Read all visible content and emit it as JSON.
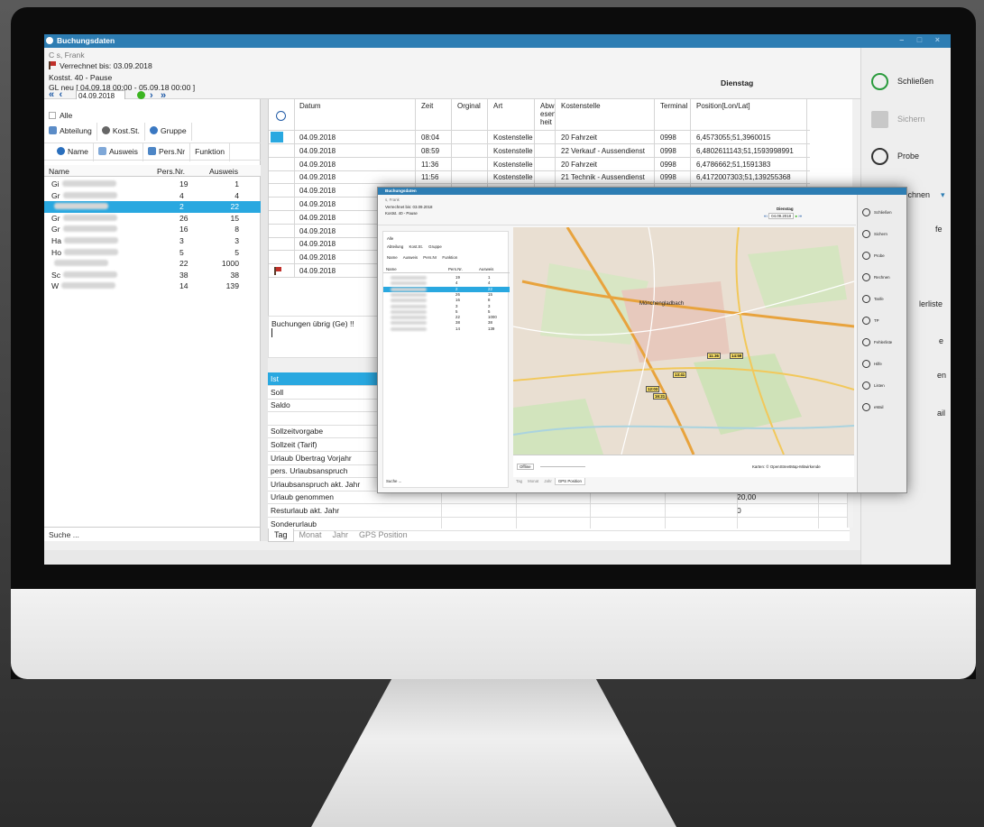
{
  "window": {
    "title": "Buchungsdaten",
    "controls": "– □ ×"
  },
  "header": {
    "person": "C    s, Frank",
    "verrechnet": "Verrechnet bis: 03.09.2018",
    "kostst": "Kostst. 40 - Pause",
    "gl": "GL neu  [ 04.09.18 00:00 - 05.09.18 00:00 ]",
    "day": "Dienstag",
    "date": "04.09.2018"
  },
  "left": {
    "alle": "Alle",
    "group_buttons": [
      "Abteilung",
      "Kost.St.",
      "Gruppe"
    ],
    "sort_buttons": [
      "Name",
      "Ausweis",
      "Pers.Nr",
      "Funktion"
    ],
    "columns": [
      "Name",
      "Pers.Nr.",
      "Ausweis"
    ],
    "rows": [
      {
        "name": "Gi",
        "pers": "19",
        "ausweis": "1"
      },
      {
        "name": "Gr",
        "pers": "4",
        "ausweis": "4"
      },
      {
        "name": "",
        "pers": "2",
        "ausweis": "22"
      },
      {
        "name": "Gr",
        "pers": "26",
        "ausweis": "15"
      },
      {
        "name": "Gr",
        "pers": "16",
        "ausweis": "8"
      },
      {
        "name": "Ha",
        "pers": "3",
        "ausweis": "3"
      },
      {
        "name": "Ho",
        "pers": "5",
        "ausweis": "5"
      },
      {
        "name": "",
        "pers": "22",
        "ausweis": "1000"
      },
      {
        "name": "Sc",
        "pers": "38",
        "ausweis": "38"
      },
      {
        "name": "W",
        "pers": "14",
        "ausweis": "139"
      }
    ],
    "search_placeholder": "Suche ..."
  },
  "main": {
    "columns": [
      "Datum",
      "Zeit",
      "Orginal",
      "Art",
      "Abw esen heit",
      "Kostenstelle",
      "Terminal",
      "Position[Lon/Lat]"
    ],
    "rows": [
      {
        "datum": "04.09.2018",
        "zeit": "08:04",
        "art": "Kostenstelle",
        "kst": "20 Fahrzeit",
        "term": "0998",
        "pos": "6,4573055;51,3960015"
      },
      {
        "datum": "04.09.2018",
        "zeit": "08:59",
        "art": "Kostenstelle",
        "kst": "22 Verkauf - Aussendienst",
        "term": "0998",
        "pos": "6,4802611143;51,1593998991"
      },
      {
        "datum": "04.09.2018",
        "zeit": "11:36",
        "art": "Kostenstelle",
        "kst": "20 Fahrzeit",
        "term": "0998",
        "pos": "6,4786662;51,1591383"
      },
      {
        "datum": "04.09.2018",
        "zeit": "11:56",
        "art": "Kostenstelle",
        "kst": "21 Technik - Aussendienst",
        "term": "0998",
        "pos": "6,4172007303;51,139255368"
      },
      {
        "datum": "04.09.2018",
        "zeit": "",
        "art": "",
        "kst": "",
        "term": "",
        "pos": ""
      },
      {
        "datum": "04.09.2018",
        "zeit": "",
        "art": "",
        "kst": "",
        "term": "",
        "pos": ""
      },
      {
        "datum": "04.09.2018",
        "zeit": "",
        "art": "",
        "kst": "",
        "term": "",
        "pos": ""
      },
      {
        "datum": "04.09.2018",
        "zeit": "",
        "art": "",
        "kst": "",
        "term": "",
        "pos": ""
      },
      {
        "datum": "04.09.2018",
        "zeit": "",
        "art": "",
        "kst": "",
        "term": "",
        "pos": ""
      },
      {
        "datum": "04.09.2018",
        "zeit": "",
        "art": "",
        "kst": "",
        "term": "",
        "pos": ""
      },
      {
        "datum": "04.09.2018",
        "zeit": "",
        "art": "",
        "kst": "",
        "term": "",
        "pos": ""
      }
    ],
    "note": "Buchungen übrig (Ge) !!",
    "summary": [
      {
        "label": "Ist",
        "value": ""
      },
      {
        "label": "Soll",
        "value": ""
      },
      {
        "label": "Saldo",
        "value": ""
      },
      {
        "label": "",
        "value": ""
      },
      {
        "label": "Sollzeitvorgabe",
        "value": ""
      },
      {
        "label": "Sollzeit (Tarif)",
        "value": ""
      },
      {
        "label": "Urlaub Übertrag Vorjahr",
        "value": ""
      },
      {
        "label": "pers. Urlaubsanspruch",
        "value": ""
      },
      {
        "label": "Urlaubsanspruch akt. Jahr",
        "value": ""
      },
      {
        "label": "Urlaub genommen",
        "value": "20,00"
      },
      {
        "label": "Resturlaub akt. Jahr",
        "value": "0"
      },
      {
        "label": "Sonderurlaub",
        "value": ""
      }
    ],
    "tabs": [
      "Tag",
      "Monat",
      "Jahr",
      "GPS Position"
    ]
  },
  "right": {
    "buttons": [
      "Schließen",
      "Sichern",
      "Probe",
      "Rechnen"
    ],
    "partial_labels": [
      "fe",
      "lerliste",
      "e",
      "en",
      "ail"
    ]
  },
  "overlay": {
    "title": "Buchungsdaten",
    "person": "s, Frank",
    "verrechnet": "Verrechnet bis: 03.09.2018",
    "kostst": "Kostst. 40 - Pause",
    "day": "Dienstag",
    "date": "04.09.2018",
    "alle": "Alle",
    "group_buttons": [
      "Abteilung",
      "Kost.St.",
      "Gruppe"
    ],
    "sort_buttons": [
      "Name",
      "Ausweis",
      "Pers.Nr",
      "Funktion"
    ],
    "columns": [
      "Name",
      "Pers.Nr.",
      "Ausweis"
    ],
    "pers": [
      "19",
      "4",
      "2",
      "26",
      "16",
      "3",
      "5",
      "22",
      "38",
      "14"
    ],
    "ausweis": [
      "1",
      "4",
      "22",
      "15",
      "8",
      "3",
      "5",
      "1000",
      "38",
      "139"
    ],
    "search_placeholder": "Suche ...",
    "city": "Mönchengladbach",
    "map_badges": [
      "11:36",
      "14:59",
      "13:41",
      "12:03",
      "16:21"
    ],
    "offline": "Offline",
    "attribution": "Karten: © OpenStreetMap-Mitwirkende",
    "tabs": [
      "Tag",
      "Monat",
      "Jahr",
      "GPS Position"
    ],
    "right_buttons": [
      "Schließen",
      "Sichern",
      "Probe",
      "Rechnen",
      "Tarife",
      "TP",
      "Fehlerliste",
      "Hilfe",
      "Listen",
      "eMail"
    ]
  },
  "colors": {
    "accent": "#29a8e0",
    "titlebar": "#2d7db3",
    "nav": "#1f5aa6",
    "ok": "#3cb521"
  }
}
